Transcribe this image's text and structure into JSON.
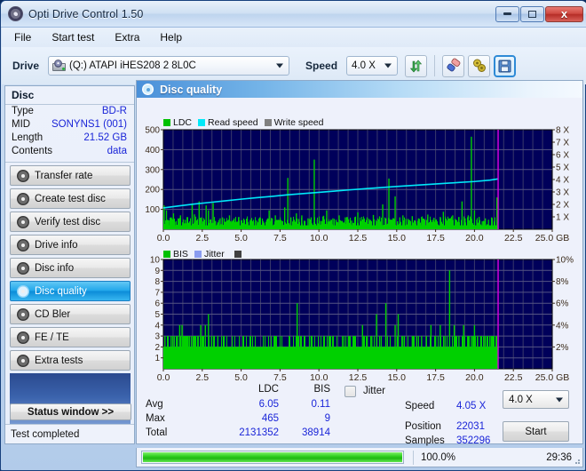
{
  "window": {
    "title": "Opti Drive Control 1.50",
    "icon": "disc-icon",
    "minimize": "–",
    "maximize": "□",
    "close": "x"
  },
  "menu": {
    "items": [
      "File",
      "Start test",
      "Extra",
      "Help"
    ]
  },
  "toolbar": {
    "drive_label": "Drive",
    "drive_value": "(Q:)  ATAPI iHES208  2 8L0C",
    "speed_label": "Speed",
    "speed_value": "4.0 X",
    "buttons": [
      {
        "name": "refresh-button",
        "icon": "refresh-arrows-icon"
      },
      {
        "name": "erase-button",
        "icon": "eraser-icon"
      },
      {
        "name": "settings-button",
        "icon": "gears-icon"
      },
      {
        "name": "save-button",
        "icon": "floppy-save-icon"
      }
    ]
  },
  "sidebar": {
    "disc_heading": "Disc",
    "info": [
      {
        "key": "Type",
        "value": "BD-R"
      },
      {
        "key": "MID",
        "value": "SONYNS1 (001)"
      },
      {
        "key": "Length",
        "value": "21.52 GB"
      },
      {
        "key": "Contents",
        "value": "data"
      }
    ],
    "nav": [
      {
        "label": "Transfer rate",
        "selected": false
      },
      {
        "label": "Create test disc",
        "selected": false
      },
      {
        "label": "Verify test disc",
        "selected": false
      },
      {
        "label": "Drive info",
        "selected": false
      },
      {
        "label": "Disc info",
        "selected": false
      },
      {
        "label": "Disc quality",
        "selected": true
      },
      {
        "label": "CD Bler",
        "selected": false
      },
      {
        "label": "FE / TE",
        "selected": false
      },
      {
        "label": "Extra tests",
        "selected": false
      }
    ],
    "status_window_button": "Status window >>",
    "status_text": "Test completed"
  },
  "panel": {
    "title": "Disc quality",
    "icon": "disc-quality-icon"
  },
  "stats": {
    "col_ldc": "LDC",
    "col_bis": "BIS",
    "rows": [
      {
        "label": "Avg",
        "ldc": "6.05",
        "bis": "0.11"
      },
      {
        "label": "Max",
        "ldc": "465",
        "bis": "9"
      },
      {
        "label": "Total",
        "ldc": "2131352",
        "bis": "38914"
      }
    ],
    "jitter_label": "Jitter",
    "jitter_checked": false,
    "speed_label": "Speed",
    "speed_value": "4.05 X",
    "position_label": "Position",
    "position_value": "22031",
    "samples_label": "Samples",
    "samples_value": "352296",
    "speed_select": "4.0 X",
    "start_button": "Start"
  },
  "progress": {
    "percent_label": "100.0%",
    "percent_value": 100,
    "elapsed": "29:36"
  },
  "colors": {
    "ldc_green": "#00d000",
    "read_speed_cyan": "#00e8f8",
    "write_speed_gray": "#808080",
    "bis_green": "#00d000",
    "jitter_blue": "#8a9cf0",
    "plot_bg": "#00005a",
    "end_marker_magenta": "#e000e0",
    "accent_blue": "#1a25d8"
  },
  "chart_data": [
    {
      "type": "line",
      "name": "disc-quality-ldc-chart",
      "title": "",
      "xlabel": "GB",
      "ylabel": "LDC",
      "xlim": [
        0,
        25.0
      ],
      "ylim": [
        0,
        500
      ],
      "y2lim": [
        0,
        8
      ],
      "y2label": "X",
      "grid": true,
      "legend_position": "top-left",
      "legend": [
        "LDC",
        "Read speed",
        "Write speed"
      ],
      "xticks": [
        "0.0",
        "2.5",
        "5.0",
        "7.5",
        "10.0",
        "12.5",
        "15.0",
        "17.5",
        "20.0",
        "22.5",
        "25.0 GB"
      ],
      "yticks": [
        "100",
        "200",
        "300",
        "400",
        "500"
      ],
      "y2ticks": [
        "1 X",
        "2 X",
        "3 X",
        "4 X",
        "5 X",
        "6 X",
        "7 X",
        "8 X"
      ],
      "data_end_gb": 21.52,
      "series": [
        {
          "name": "LDC",
          "color": "#00d000",
          "type": "spikes",
          "baseline": 20,
          "x": [
            0.05,
            0.2,
            0.35,
            0.5,
            0.65,
            0.8,
            0.95,
            1.1,
            1.25,
            1.4,
            1.55,
            1.7,
            1.85,
            2.0,
            2.15,
            2.3,
            2.45,
            2.6,
            2.75,
            2.9,
            3.05,
            3.2,
            3.35,
            3.5,
            3.65,
            3.8,
            3.95,
            4.1,
            4.25,
            4.4,
            4.55,
            4.7,
            4.85,
            5.0,
            5.2,
            5.4,
            5.6,
            5.8,
            6.0,
            6.2,
            6.4,
            6.6,
            6.8,
            7.0,
            7.2,
            7.4,
            7.6,
            7.8,
            8.0,
            8.2,
            8.4,
            8.55,
            8.7,
            8.9,
            9.1,
            9.3,
            9.5,
            9.7,
            9.9,
            10.1,
            10.3,
            10.5,
            10.7,
            10.9,
            11.1,
            11.3,
            11.5,
            11.7,
            11.9,
            12.1,
            12.3,
            12.5,
            12.7,
            12.9,
            13.1,
            13.3,
            13.5,
            13.7,
            13.9,
            14.1,
            14.3,
            14.5,
            14.7,
            14.9,
            15.05,
            15.2,
            15.4,
            15.6,
            15.8,
            16.0,
            16.2,
            16.4,
            16.6,
            16.8,
            17.0,
            17.2,
            17.4,
            17.6,
            17.8,
            18.0,
            18.2,
            18.4,
            18.6,
            18.8,
            19.0,
            19.2,
            19.4,
            19.6,
            19.8,
            20.0,
            20.15,
            20.3,
            20.5,
            20.7,
            20.9,
            21.1,
            21.3,
            21.45
          ],
          "y": [
            120,
            95,
            45,
            60,
            80,
            38,
            55,
            70,
            35,
            48,
            62,
            40,
            130,
            75,
            45,
            140,
            60,
            38,
            120,
            95,
            50,
            132,
            42,
            35,
            55,
            60,
            38,
            45,
            70,
            42,
            55,
            38,
            62,
            45,
            40,
            52,
            48,
            38,
            44,
            60,
            42,
            38,
            95,
            55,
            70,
            48,
            42,
            110,
            258,
            60,
            45,
            80,
            52,
            70,
            42,
            55,
            60,
            350,
            48,
            42,
            68,
            95,
            40,
            55,
            48,
            70,
            42,
            60,
            50,
            44,
            38,
            85,
            42,
            55,
            60,
            48,
            72,
            40,
            65,
            125,
            55,
            255,
            48,
            165,
            40,
            60,
            70,
            52,
            48,
            66,
            40,
            55,
            62,
            48,
            74,
            42,
            58,
            40,
            62,
            88,
            46,
            55,
            70,
            48,
            62,
            140,
            55,
            70,
            465,
            95,
            48,
            62,
            40,
            55,
            48,
            60,
            42,
            160
          ]
        },
        {
          "name": "Read speed",
          "color": "#00e8f8",
          "type": "line",
          "x": [
            0.0,
            1.0,
            2.0,
            3.0,
            4.0,
            5.0,
            6.0,
            7.0,
            8.0,
            9.0,
            10.0,
            11.0,
            12.0,
            13.0,
            14.0,
            15.0,
            16.0,
            17.0,
            18.0,
            19.0,
            20.0,
            21.0,
            21.52
          ],
          "y_speed_x": [
            1.72,
            1.88,
            2.03,
            2.16,
            2.29,
            2.42,
            2.54,
            2.65,
            2.77,
            2.87,
            2.97,
            3.07,
            3.17,
            3.26,
            3.35,
            3.44,
            3.52,
            3.6,
            3.68,
            3.76,
            3.84,
            3.95,
            4.05
          ]
        },
        {
          "name": "Write speed",
          "color": "#808080",
          "type": "line",
          "x": [],
          "y": []
        }
      ]
    },
    {
      "type": "line",
      "name": "disc-quality-bis-chart",
      "title": "",
      "xlabel": "GB",
      "ylabel": "BIS",
      "xlim": [
        0,
        25.0
      ],
      "ylim": [
        0,
        10
      ],
      "y2lim": [
        0,
        10
      ],
      "y2label": "%",
      "grid": true,
      "legend_position": "top-left",
      "legend": [
        "BIS",
        "Jitter"
      ],
      "xticks": [
        "0.0",
        "2.5",
        "5.0",
        "7.5",
        "10.0",
        "12.5",
        "15.0",
        "17.5",
        "20.0",
        "22.5",
        "25.0 GB"
      ],
      "yticks": [
        "1",
        "2",
        "3",
        "4",
        "5",
        "6",
        "7",
        "8",
        "9",
        "10"
      ],
      "y2ticks": [
        "2%",
        "4%",
        "6%",
        "8%",
        "10%"
      ],
      "data_end_gb": 21.52,
      "series": [
        {
          "name": "BIS",
          "color": "#00d000",
          "type": "spikes",
          "baseline": 2,
          "x": [
            0.1,
            0.3,
            0.5,
            0.7,
            0.9,
            1.05,
            1.2,
            1.4,
            1.6,
            1.8,
            2.0,
            2.2,
            2.4,
            2.55,
            2.7,
            2.9,
            3.1,
            3.3,
            3.5,
            3.6,
            3.8,
            4.0,
            4.2,
            4.4,
            4.6,
            4.8,
            5.0,
            5.3,
            5.6,
            5.9,
            6.2,
            6.5,
            6.8,
            7.1,
            7.4,
            7.7,
            8.0,
            8.3,
            8.6,
            8.9,
            9.2,
            9.5,
            9.8,
            10.1,
            10.4,
            10.7,
            11.0,
            11.3,
            11.6,
            11.9,
            12.2,
            12.5,
            12.8,
            13.1,
            13.4,
            13.7,
            14.0,
            14.3,
            14.6,
            14.9,
            15.1,
            15.4,
            15.7,
            16.0,
            16.3,
            16.6,
            16.9,
            17.2,
            17.5,
            17.8,
            18.1,
            18.4,
            18.7,
            19.0,
            19.3,
            19.6,
            19.8,
            20.0,
            20.2,
            20.4,
            20.6,
            20.8,
            21.0,
            21.2,
            21.4
          ],
          "y": [
            3,
            3,
            3,
            3,
            3,
            4,
            4,
            3,
            3,
            3,
            3,
            3,
            4,
            3,
            4,
            5,
            3,
            2,
            3,
            1,
            2,
            2,
            2,
            2,
            2,
            2,
            2,
            2,
            2,
            2,
            2,
            1,
            2,
            2,
            1,
            2,
            1,
            2,
            6,
            2,
            2,
            3,
            2,
            2,
            2,
            3,
            2,
            2,
            3,
            3,
            2,
            2,
            4,
            3,
            3,
            5,
            3,
            6,
            2,
            4,
            5,
            3,
            2,
            3,
            3,
            3,
            3,
            4,
            3,
            4,
            3,
            9,
            4,
            3,
            4,
            3,
            3,
            4,
            3,
            3,
            3,
            3,
            3,
            3,
            3
          ]
        },
        {
          "name": "Jitter",
          "color": "#8a9cf0",
          "type": "line",
          "x": [],
          "y": []
        }
      ]
    }
  ]
}
